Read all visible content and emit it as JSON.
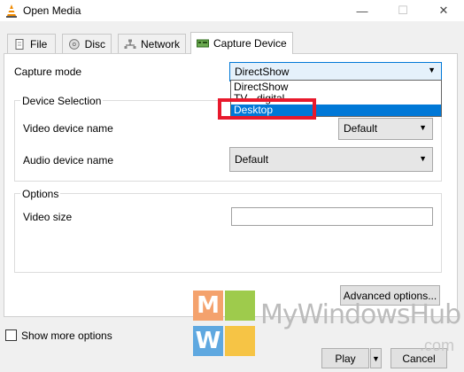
{
  "window": {
    "title": "Open Media"
  },
  "tabs": [
    {
      "label": "File"
    },
    {
      "label": "Disc"
    },
    {
      "label": "Network"
    },
    {
      "label": "Capture Device"
    }
  ],
  "capture_mode": {
    "label": "Capture mode",
    "value": "DirectShow"
  },
  "dropdown": {
    "options": [
      "DirectShow",
      "TV - digital",
      "Desktop"
    ],
    "selected": "Desktop"
  },
  "device_selection": {
    "title": "Device Selection",
    "video_label": "Video device name",
    "video_value": "Default",
    "audio_label": "Audio device name",
    "audio_value": "Default"
  },
  "options": {
    "title": "Options",
    "video_size_label": "Video size",
    "video_size_value": ""
  },
  "buttons": {
    "advanced": "Advanced options...",
    "play": "Play",
    "cancel": "Cancel"
  },
  "show_more": {
    "label": "Show more options",
    "checked": false
  },
  "watermark": {
    "brand": "MyWindowsHub",
    "tld": ".com",
    "tiles": [
      "M",
      "W"
    ]
  },
  "colors": {
    "highlight": "#e8192c",
    "selection": "#0078d7"
  }
}
